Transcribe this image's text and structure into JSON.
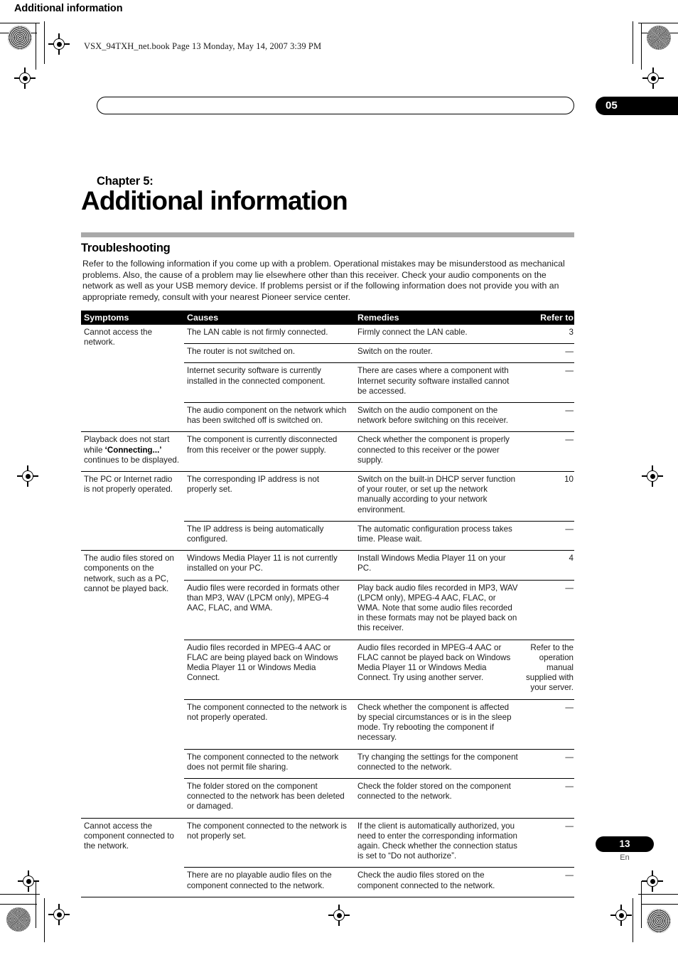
{
  "print_header": {
    "book_line": "VSX_94TXH_net.book  Page 13  Monday, May 14, 2007  3:39 PM"
  },
  "running_head": {
    "title": "Additional information",
    "chapter_number": "05"
  },
  "chapter": {
    "label": "Chapter 5:",
    "title": "Additional information"
  },
  "section": {
    "title": "Troubleshooting",
    "intro": "Refer to the following information if you come up with a problem. Operational mistakes may be misunderstood as mechanical problems. Also, the cause of a problem may lie elsewhere other than this receiver. Check your audio components on the network as well as your USB memory device. If problems persist or if the following information does not provide you with an appropriate remedy, consult with your nearest Pioneer service center."
  },
  "table": {
    "headers": {
      "symptoms": "Symptoms",
      "causes": "Causes",
      "remedies": "Remedies",
      "refer_to": "Refer to"
    },
    "groups": [
      {
        "symptom": "Cannot access the network.",
        "symptom_bold": "",
        "rows": [
          {
            "cause": "The LAN cable is not firmly connected.",
            "remedy": "Firmly connect the LAN cable.",
            "refer": "3"
          },
          {
            "cause": "The router is not switched on.",
            "remedy": "Switch on the router.",
            "refer": "—"
          },
          {
            "cause": "Internet security software is currently installed in the connected component.",
            "remedy": "There are cases where a component with Internet security software installed cannot be accessed.",
            "refer": "—"
          },
          {
            "cause": "The audio component on the network which has been switched off is switched on.",
            "remedy": "Switch on the audio component on the network before switching on this receiver.",
            "refer": "—"
          }
        ]
      },
      {
        "symptom_pre": "Playback does not start while ",
        "symptom_bold": "‘Connecting...’",
        "symptom_post": " continues to be displayed.",
        "rows": [
          {
            "cause": "The component is currently disconnected from this receiver or the power supply.",
            "remedy": "Check whether the component is properly connected to this receiver or the power supply.",
            "refer": "—"
          }
        ]
      },
      {
        "symptom": "The PC or Internet radio is not properly operated.",
        "rows": [
          {
            "cause": "The corresponding IP address is not properly set.",
            "remedy": "Switch on the built-in DHCP server function of your router, or set up the network manually according to your network environment.",
            "refer": "10"
          },
          {
            "cause": "The IP address is being automatically configured.",
            "remedy": "The automatic configuration process takes time. Please wait.",
            "refer": "—"
          }
        ]
      },
      {
        "symptom": "The audio files stored on components on the network, such as a PC, cannot be played back.",
        "rows": [
          {
            "cause": "Windows Media Player 11 is not currently installed on your PC.",
            "remedy": "Install Windows Media Player 11 on your PC.",
            "refer": "4"
          },
          {
            "cause": "Audio files were recorded in formats other than MP3, WAV (LPCM only), MPEG-4 AAC, FLAC, and WMA.",
            "remedy": "Play back audio files recorded in MP3, WAV (LPCM only), MPEG-4 AAC, FLAC, or WMA. Note that some audio files recorded in these formats may not be played back on this receiver.",
            "refer": "—"
          },
          {
            "cause": "Audio files recorded in MPEG-4 AAC or FLAC are being played back on Windows Media Player 11 or Windows Media Connect.",
            "remedy": "Audio files recorded in MPEG-4 AAC or FLAC cannot be played back on Windows Media Player 11 or Windows Media Connect. Try using another server.",
            "refer": "Refer to the operation manual supplied with your server."
          },
          {
            "cause": "The component connected to the network is not properly operated.",
            "remedy": "Check whether the component is affected by special circumstances or is in the sleep mode. Try rebooting the component if necessary.",
            "refer": "—"
          },
          {
            "cause": "The component connected to the network does not permit file sharing.",
            "remedy": "Try changing the settings for the component connected to the network.",
            "refer": "—"
          },
          {
            "cause": "The folder stored on the component connected to the network has been deleted or damaged.",
            "remedy": "Check the folder stored on the component connected to the network.",
            "refer": "—"
          }
        ]
      },
      {
        "symptom": "Cannot access the component connected to the network.",
        "rows": [
          {
            "cause": "The component connected to the network is not properly set.",
            "remedy": "If the client is automatically authorized, you need to enter the corresponding information again. Check whether the connection status is set to “Do not authorize”.",
            "refer": "—"
          },
          {
            "cause": "There are no playable audio files on the component connected to the network.",
            "remedy": "Check the audio files stored on the component connected to the network.",
            "refer": "—"
          }
        ]
      }
    ]
  },
  "footer": {
    "page_number": "13",
    "language": "En"
  },
  "colors": {
    "section_bar": "#a9a9a9",
    "header_band": "#000000",
    "text": "#1c1c1c"
  }
}
